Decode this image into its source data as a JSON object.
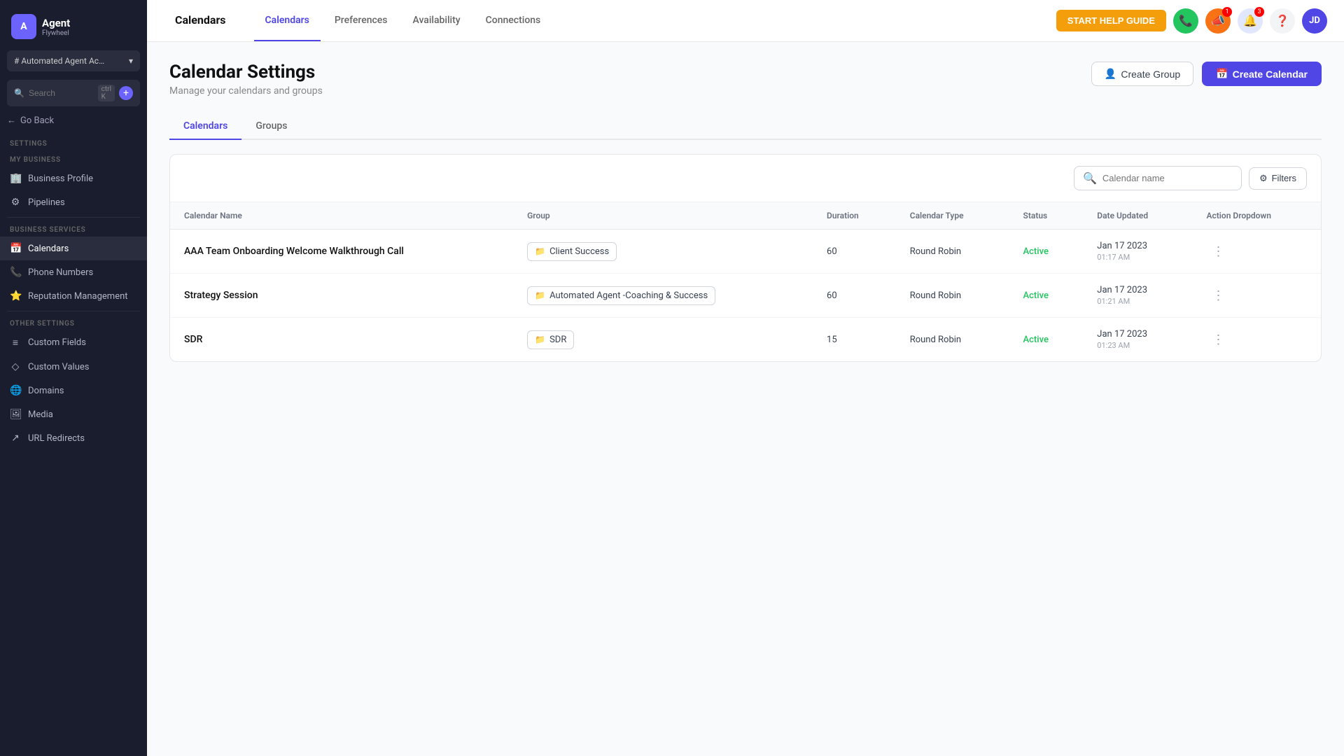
{
  "sidebar": {
    "logo": {
      "icon": "A",
      "text": "Agent",
      "sub": "Flywheel"
    },
    "account": "# Automated Agent Acad...",
    "search": {
      "placeholder": "Search",
      "shortcut": "ctrl K"
    },
    "go_back": "← Go Back",
    "settings_label": "Settings",
    "my_business_label": "MY BUSINESS",
    "business_services_label": "BUSINESS SERVICES",
    "other_settings_label": "OTHER SETTINGS",
    "nav_items_my_business": [
      {
        "id": "business-profile",
        "label": "Business Profile",
        "icon": "🏢"
      },
      {
        "id": "pipelines",
        "label": "Pipelines",
        "icon": "⚙"
      }
    ],
    "nav_items_business_services": [
      {
        "id": "calendars",
        "label": "Calendars",
        "icon": "📅",
        "active": true
      },
      {
        "id": "phone-numbers",
        "label": "Phone Numbers",
        "icon": "📞"
      },
      {
        "id": "reputation",
        "label": "Reputation Management",
        "icon": "⭐"
      }
    ],
    "nav_items_other": [
      {
        "id": "custom-fields",
        "label": "Custom Fields",
        "icon": "≡"
      },
      {
        "id": "custom-values",
        "label": "Custom Values",
        "icon": "◇"
      },
      {
        "id": "domains",
        "label": "Domains",
        "icon": "🌐"
      },
      {
        "id": "media",
        "label": "Media",
        "icon": "🖼"
      },
      {
        "id": "url-redirects",
        "label": "URL Redirects",
        "icon": "↗"
      }
    ]
  },
  "topnav": {
    "main_tab": "Calendars",
    "tabs": [
      {
        "id": "calendars",
        "label": "Calendars",
        "active": true
      },
      {
        "id": "preferences",
        "label": "Preferences"
      },
      {
        "id": "availability",
        "label": "Availability"
      },
      {
        "id": "connections",
        "label": "Connections"
      }
    ],
    "help_guide": "START HELP GUIDE",
    "avatar": "JD"
  },
  "page": {
    "title": "Calendar Settings",
    "subtitle": "Manage your calendars and groups",
    "create_group_label": "Create Group",
    "create_calendar_label": "Create Calendar",
    "sub_tabs": [
      {
        "id": "calendars-tab",
        "label": "Calendars",
        "active": true
      },
      {
        "id": "groups-tab",
        "label": "Groups"
      }
    ],
    "table": {
      "search_placeholder": "Calendar name",
      "filter_label": "Filters",
      "columns": [
        "Calendar Name",
        "Group",
        "Duration",
        "Calendar Type",
        "Status",
        "Date Updated",
        "Action Dropdown"
      ],
      "rows": [
        {
          "name": "AAA Team Onboarding Welcome Walkthrough Call",
          "group": "Client Success",
          "duration": "60",
          "type": "Round Robin",
          "status": "Active",
          "date": "Jan 17 2023",
          "time": "01:17 AM"
        },
        {
          "name": "Strategy Session",
          "group": "Automated Agent -Coaching & Success",
          "duration": "60",
          "type": "Round Robin",
          "status": "Active",
          "date": "Jan 17 2023",
          "time": "01:21 AM"
        },
        {
          "name": "SDR",
          "group": "SDR",
          "duration": "15",
          "type": "Round Robin",
          "status": "Active",
          "date": "Jan 17 2023",
          "time": "01:23 AM"
        }
      ]
    }
  }
}
